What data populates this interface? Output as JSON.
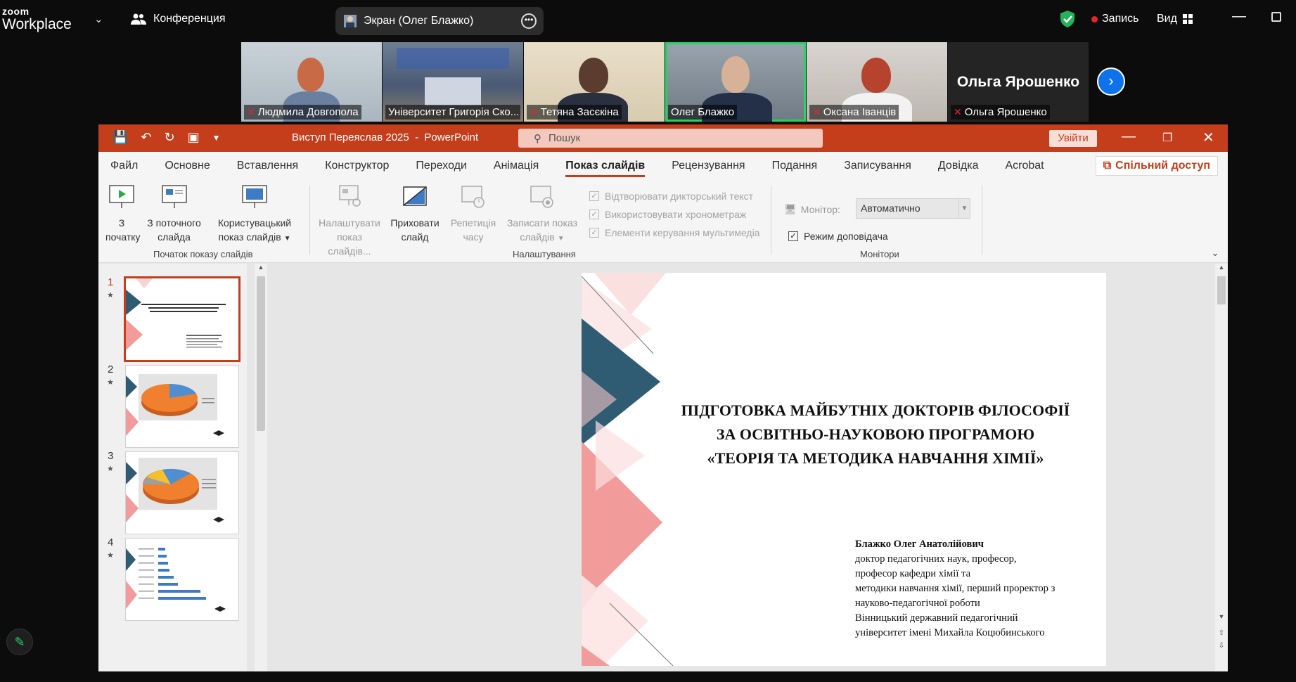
{
  "zoom": {
    "logo_line1": "zoom",
    "logo_line2": "Workplace",
    "conference_label": "Конференция",
    "screen_share_label": "Экран (Олег Блажко)",
    "record_label": "Запись",
    "view_label": "Вид"
  },
  "participants": [
    {
      "name": "Людмила Довгопола",
      "muted": true
    },
    {
      "name": "Університет Григорія Ско...",
      "muted": false
    },
    {
      "name": "Тетяна Засєкіна",
      "muted": true
    },
    {
      "name": "Олег Блажко",
      "muted": false,
      "active": true
    },
    {
      "name": "Оксана Іванців",
      "muted": true
    },
    {
      "name": "Ольга Ярошенко",
      "muted": true,
      "big_name": "Ольга Ярошенко"
    }
  ],
  "ppt": {
    "doc_title": "Виступ Переяслав 2025",
    "app_name": "PowerPoint",
    "search_placeholder": "Пошук",
    "sign_in": "Увійти",
    "share_label": "Спільний доступ",
    "tabs": [
      "Файл",
      "Основне",
      "Вставлення",
      "Конструктор",
      "Переходи",
      "Анімація",
      "Показ слайдів",
      "Рецензування",
      "Подання",
      "Записування",
      "Довідка",
      "Acrobat"
    ],
    "active_tab": "Показ слайдів",
    "ribbon": {
      "from_start_1": "З",
      "from_start_2": "початку",
      "from_current_1": "З поточного",
      "from_current_2": "слайда",
      "custom_1": "Користувацький",
      "custom_2": "показ слайдів",
      "group_start": "Початок показу слайдів",
      "setup_1": "Налаштувати",
      "setup_2": "показ слайдів...",
      "hide_1": "Приховати",
      "hide_2": "слайд",
      "rehearse_1": "Репетиція",
      "rehearse_2": "часу",
      "record_1": "Записати показ",
      "record_2": "слайдів",
      "chk_narration": "Відтворювати дикторський текст",
      "chk_timings": "Використовувати хронометраж",
      "chk_media": "Елементи керування мультимедіа",
      "group_setup": "Налаштування",
      "monitor_label": "Монітор:",
      "monitor_value": "Автоматично",
      "presenter_view": "Режим доповідача",
      "group_monitors": "Монітори"
    },
    "slides": [
      {
        "num": "1",
        "selected": true
      },
      {
        "num": "2"
      },
      {
        "num": "3"
      },
      {
        "num": "4"
      }
    ],
    "slide": {
      "title_1": "ПІДГОТОВКА МАЙБУТНІХ ДОКТОРІВ ФІЛОСОФІЇ",
      "title_2": "ЗА ОСВІТНЬО-НАУКОВОЮ ПРОГРАМОЮ",
      "title_3": "«ТЕОРІЯ ТА МЕТОДИКА НАВЧАННЯ ХІМІЇ»",
      "author_name": "Блажко Олег Анатолійович",
      "author_l1": "доктор педагогічних наук, професор,",
      "author_l2": "професор кафедри хімії та",
      "author_l3": "методики навчання хімії, перший проректор з",
      "author_l4": "науково-педагогічної роботи",
      "author_l5": "Вінницький державний педагогічний",
      "author_l6": "університет імені Михайла Коцюбинського"
    }
  }
}
